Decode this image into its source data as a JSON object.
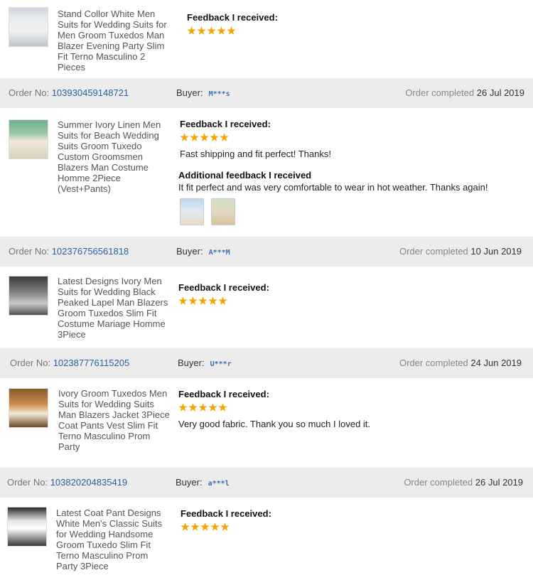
{
  "feedback_label": "Feedback I received:",
  "additional_label": "Additional feedback I received",
  "order_prefix": "Order No:",
  "buyer_label": "Buyer:",
  "completed_label": "Order completed",
  "items": [
    {
      "title": "Stand Collor White Men Suits for Wedding Suits for Men Groom Tuxedos Man Blazer Evening Party Slim Fit Terno Masculino 2 Pieces",
      "rating": 5,
      "feedback": "",
      "order_no": "103930459148721",
      "buyer": "M***s",
      "completed_date": "26 Jul 2019"
    },
    {
      "title": "Summer Ivory Linen Men Suits for Beach Wedding Suits Groom Tuxedo Custom Groomsmen Blazers Man Costume Homme 2Piece (Vest+Pants)",
      "rating": 5,
      "feedback": "Fast shipping and fit perfect! Thanks!",
      "additional": "It fit perfect and was very comfortable to wear in hot weather. Thanks again!",
      "order_no": "102376756561818",
      "buyer": "A***M",
      "completed_date": "10 Jun 2019"
    },
    {
      "title": "Latest Designs Ivory Men Suits for Wedding Black Peaked Lapel Man Blazers Groom Tuxedos Slim Fit Costume Mariage Homme 3Piece",
      "rating": 5,
      "feedback": "",
      "order_no": "102387776115205",
      "buyer": "U***r",
      "completed_date": "24 Jun 2019"
    },
    {
      "title": "Ivory Groom Tuxedos Men Suits for Wedding Suits Man Blazers Jacket 3Piece Coat Pants Vest Slim Fit Terno Masculino Prom Party",
      "rating": 5,
      "feedback": "Very good fabric. Thank you so much I loved it.",
      "order_no": "103820204835419",
      "buyer": "a***l",
      "completed_date": "26 Jul 2019"
    },
    {
      "title": "Latest Coat Pant Designs White Men's Classic Suits for Wedding Handsome Groom Tuxedo Slim Fit Terno Masculino Prom Party 3Piece",
      "rating": 5,
      "feedback": ""
    }
  ],
  "colors": {
    "star": "#f4a300",
    "link": "#2a5fa7",
    "bar": "#ececec"
  }
}
